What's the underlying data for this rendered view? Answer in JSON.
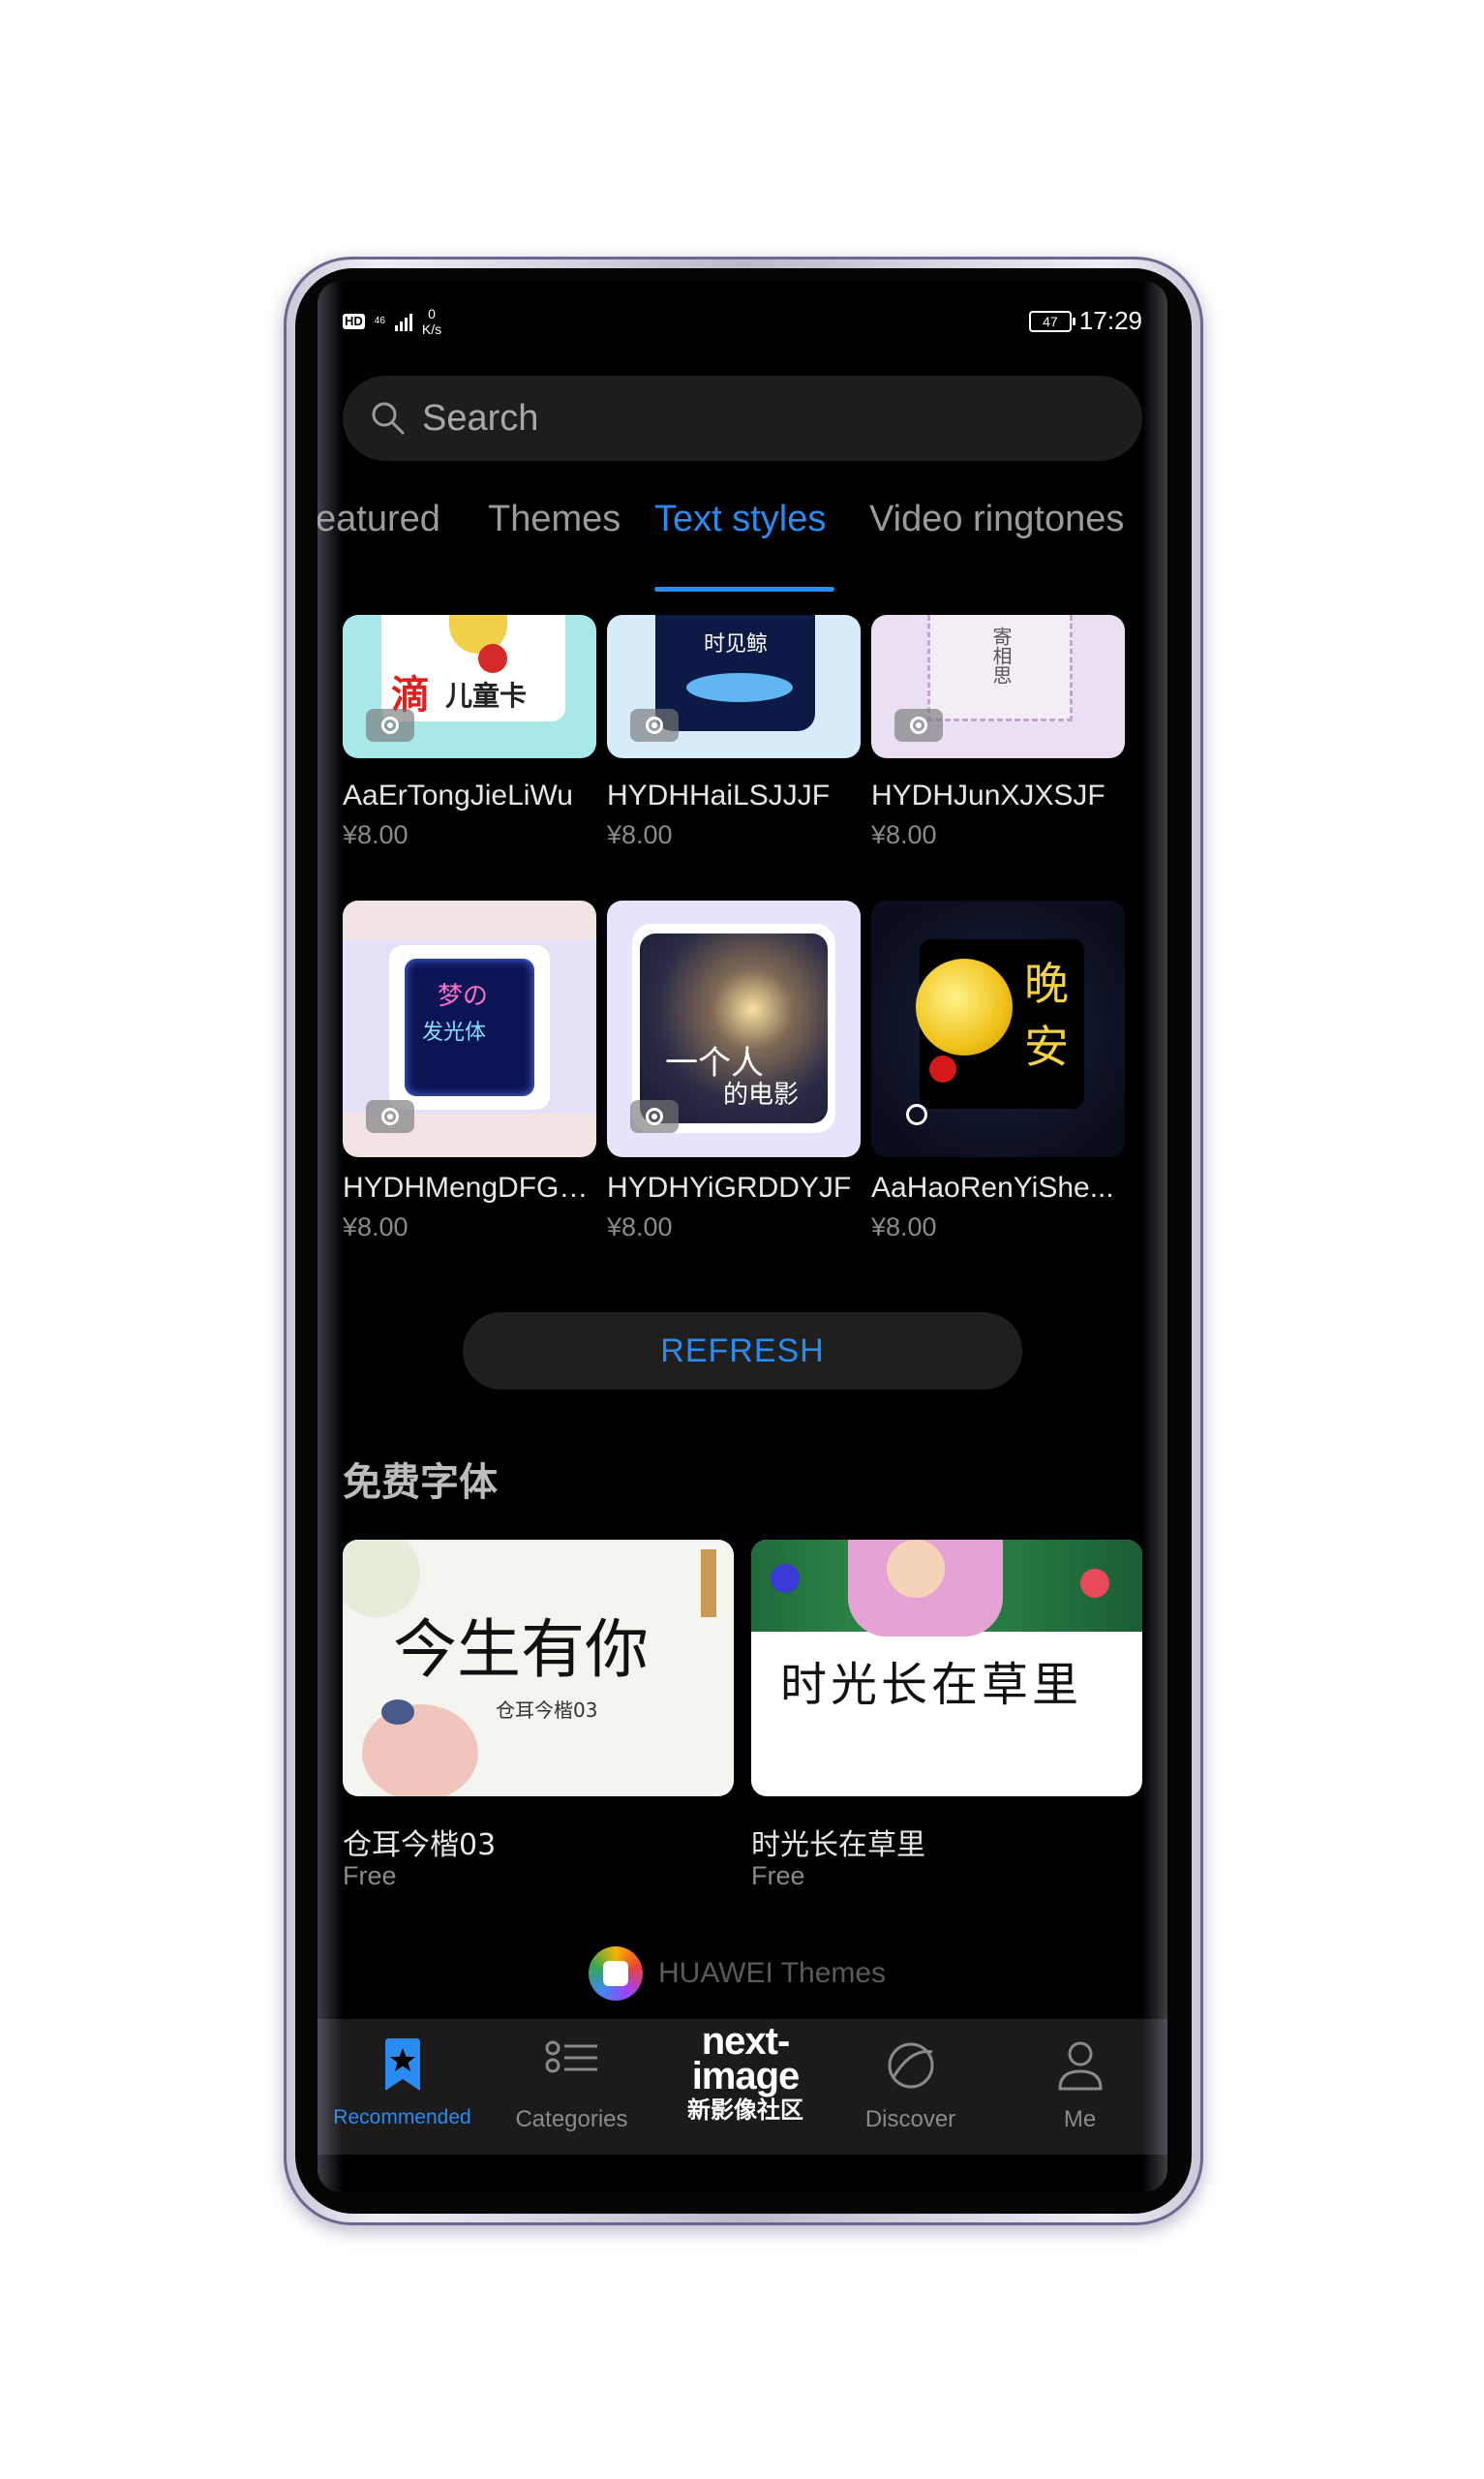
{
  "status_bar": {
    "hd": "HD",
    "network": "46",
    "speed_value": "0",
    "speed_unit": "K/s",
    "battery": "47",
    "time": "17:29"
  },
  "search": {
    "placeholder": "Search"
  },
  "tabs": [
    {
      "label": "eatured"
    },
    {
      "label": "Themes"
    },
    {
      "label": "Text styles",
      "active": true
    },
    {
      "label": "Video ringtones"
    }
  ],
  "grid_items": [
    {
      "title": "AaErTongJieLiWu",
      "price": "¥8.00",
      "thumb_text_1": "滴",
      "thumb_text_2": "儿童卡"
    },
    {
      "title": "HYDHHaiLSJJJF",
      "price": "¥8.00",
      "thumb_text_1": "时见鲸"
    },
    {
      "title": "HYDHJunXJXSJF",
      "price": "¥8.00",
      "thumb_text_1": "寄相思"
    },
    {
      "title": "HYDHMengDFGT...",
      "price": "¥8.00",
      "thumb_text_1": "梦の",
      "thumb_text_2": "发光体"
    },
    {
      "title": "HYDHYiGRDDYJF",
      "price": "¥8.00",
      "thumb_text_1": "一个人",
      "thumb_text_2": "的电影"
    },
    {
      "title": "AaHaoRenYiShe...",
      "price": "¥8.00",
      "thumb_text_1": "晚",
      "thumb_text_2": "安"
    }
  ],
  "refresh_label": "REFRESH",
  "free_section": {
    "title": "免费字体",
    "items": [
      {
        "title": "仓耳今楷03",
        "price": "Free",
        "thumb_text_1": "今生有你",
        "thumb_text_2": "仓耳今楷03"
      },
      {
        "title": "时光长在草里",
        "price": "Free",
        "thumb_text_1": "时光长在草里"
      }
    ]
  },
  "brand": {
    "name": "HUAWEI Themes"
  },
  "nav": [
    {
      "label": "Recommended",
      "icon": "bookmark-star-icon",
      "active": true
    },
    {
      "label": "Categories",
      "icon": "list-icon"
    },
    {
      "label": "",
      "icon": ""
    },
    {
      "label": "Discover",
      "icon": "planet-icon"
    },
    {
      "label": "Me",
      "icon": "person-icon"
    }
  ],
  "watermark": {
    "line1": "next-",
    "line2": "image",
    "line3": "新影像社区"
  },
  "colors": {
    "accent": "#2a8cf0",
    "background": "#000000",
    "surface": "#1d1d1d"
  }
}
